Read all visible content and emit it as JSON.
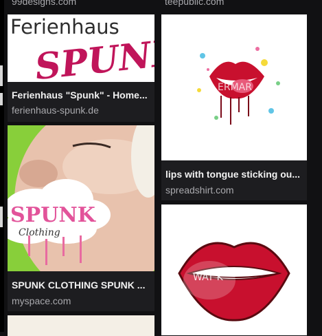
{
  "top_partials": {
    "left_domain": "99designs.com",
    "right_domain": "teepublic.com"
  },
  "results": [
    {
      "title": "Ferienhaus \"Spunk\" - Home...",
      "domain": "ferienhaus-spunk.de",
      "image_text": {
        "line1": "Ferienhaus",
        "line2": "SPUNK"
      }
    },
    {
      "title": "SPUNK CLOTHING SPUNK ...",
      "domain": "myspace.com",
      "image_text": {
        "line1": "SPUNK",
        "line2": "Clothing"
      }
    },
    {
      "title": "lips with tongue sticking ou...",
      "domain": "spreadshirt.com",
      "image_text": {
        "watermark": "ERMAR"
      }
    },
    {
      "title": "",
      "domain": "",
      "image_text": {
        "watermark": "WAT      K"
      }
    }
  ],
  "colors": {
    "page_bg": "#111113",
    "card_bg": "#1d1d20",
    "title_text": "#f1f1f1",
    "domain_text": "#a9a9ad",
    "brand_magenta": "#c0155a",
    "lip_red": "#c8102e"
  }
}
